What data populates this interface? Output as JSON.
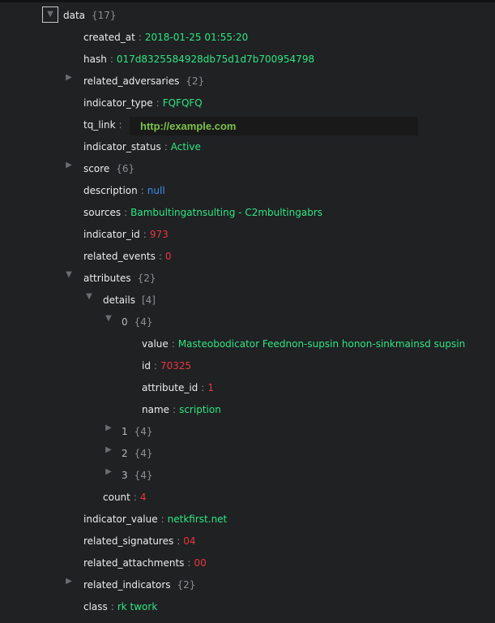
{
  "colors": {
    "background": "#1f2123",
    "key": "#ececec",
    "string": "#2ee683",
    "number": "#e8373e",
    "null": "#3b8ee8",
    "link": "#7cc24a"
  },
  "rows": [
    {
      "key": "data",
      "count": "{17}",
      "level": 0,
      "toggle": "expanded",
      "root": true
    },
    {
      "key": "created_at",
      "value": "2018-01-25 01:55:20",
      "type": "string",
      "level": 1
    },
    {
      "key": "hash",
      "value": "017d8325584928db75d1d7b700954798",
      "type": "string",
      "level": 1
    },
    {
      "key": "related_adversaries",
      "count": "{2}",
      "level": 1,
      "toggle": "collapsed"
    },
    {
      "key": "indicator_type",
      "value": "FQFQFQ",
      "type": "string",
      "level": 1
    },
    {
      "key": "tq_link",
      "link": "http://example.com",
      "level": 1
    },
    {
      "key": "indicator_status",
      "value": "Active",
      "type": "string",
      "level": 1
    },
    {
      "key": "score",
      "count": "{6}",
      "level": 1,
      "toggle": "collapsed"
    },
    {
      "key": "description",
      "value": "null",
      "type": "null",
      "level": 1
    },
    {
      "key": "sources",
      "value": "Bambultingatnsulting - C2mbultingabrs",
      "type": "string",
      "level": 1
    },
    {
      "key": "indicator_id",
      "value": "973",
      "type": "number",
      "level": 1
    },
    {
      "key": "related_events",
      "value": "0",
      "type": "number",
      "level": 1
    },
    {
      "key": "attributes",
      "count": "{2}",
      "level": 1,
      "toggle": "expanded"
    },
    {
      "key": "details",
      "count": "[4]",
      "level": 2,
      "toggle": "expanded"
    },
    {
      "key": "0",
      "count": "{4}",
      "level": 3,
      "toggle": "expanded",
      "index": true
    },
    {
      "key": "value",
      "value": "Masteobodicator Feednon-supsin  honon-sinkmainsd  supsin",
      "type": "string",
      "level": 4
    },
    {
      "key": "id",
      "value": "70325",
      "type": "number",
      "level": 4
    },
    {
      "key": "attribute_id",
      "value": "1",
      "type": "number",
      "level": 4
    },
    {
      "key": "name",
      "value": "scription",
      "type": "string",
      "level": 4
    },
    {
      "key": "1",
      "count": "{4}",
      "level": 3,
      "toggle": "collapsed",
      "index": true
    },
    {
      "key": "2",
      "count": "{4}",
      "level": 3,
      "toggle": "collapsed",
      "index": true
    },
    {
      "key": "3",
      "count": "{4}",
      "level": 3,
      "toggle": "collapsed",
      "index": true
    },
    {
      "key": "count",
      "value": "4",
      "type": "number",
      "level": 2
    },
    {
      "key": "indicator_value",
      "value": "netkfirst.net",
      "type": "string",
      "level": 1
    },
    {
      "key": "related_signatures",
      "value": "04",
      "type": "number",
      "level": 1
    },
    {
      "key": "related_attachments",
      "value": "00",
      "type": "number",
      "level": 1
    },
    {
      "key": "related_indicators",
      "count": "{2}",
      "level": 1,
      "toggle": "collapsed"
    },
    {
      "key": "class",
      "value": "rk twork",
      "type": "string",
      "level": 1
    }
  ]
}
